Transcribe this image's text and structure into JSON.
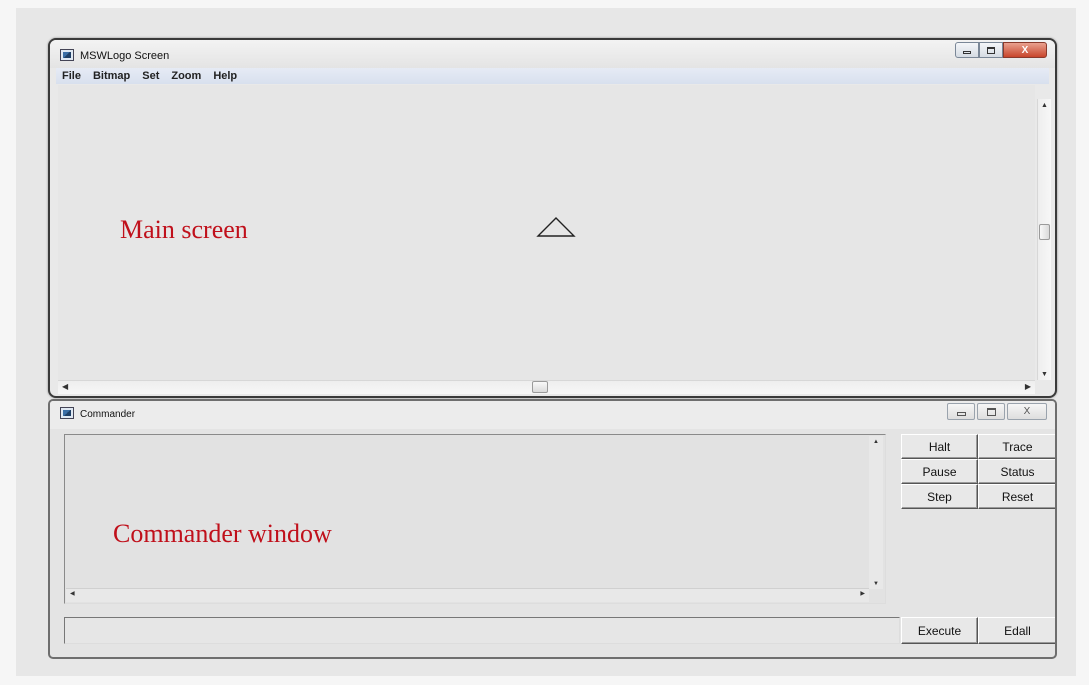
{
  "main_window": {
    "title": "MSWLogo Screen",
    "menu": [
      "File",
      "Bitmap",
      "Set",
      "Zoom",
      "Help"
    ],
    "controls": {
      "close_glyph": "X"
    },
    "annotation": "Main screen",
    "turtle_icon": "triangle-turtle"
  },
  "commander": {
    "title": "Commander",
    "controls": {
      "close_glyph": "X"
    },
    "annotation": "Commander window",
    "input_value": "",
    "buttons": {
      "halt": "Halt",
      "trace": "Trace",
      "pause": "Pause",
      "status": "Status",
      "step": "Step",
      "reset": "Reset",
      "execute": "Execute",
      "edall": "Edall"
    }
  },
  "colors": {
    "annotation_red": "#c0101b",
    "menubar_blue": "#d8e0ee",
    "close_red": "#c8452b"
  }
}
